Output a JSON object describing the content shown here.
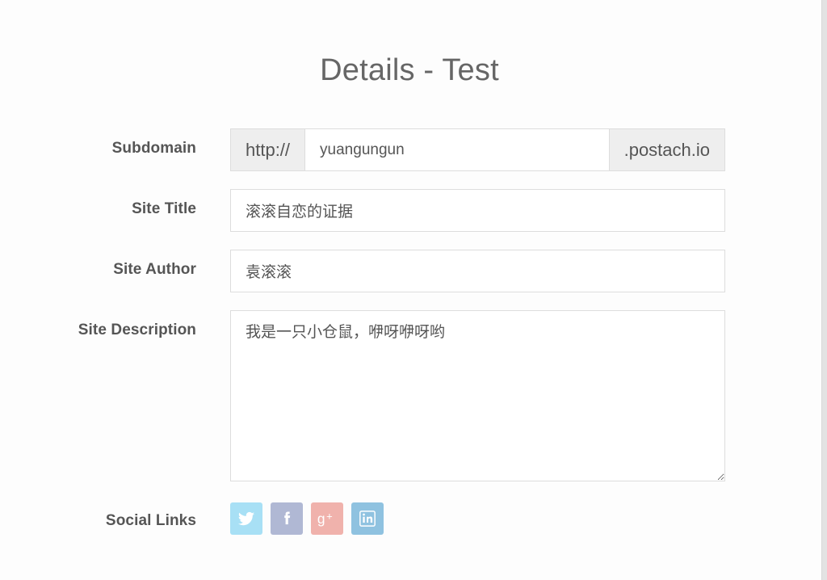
{
  "page": {
    "title": "Details - Test",
    "background_color": "#fdfdfd",
    "title_color": "#666666"
  },
  "form": {
    "subdomain": {
      "label": "Subdomain",
      "prefix": "http://",
      "value": "yuangungun",
      "placeholder": "",
      "suffix": ".postach.io"
    },
    "site_title": {
      "label": "Site Title",
      "value": "滚滚自恋的证据",
      "placeholder": ""
    },
    "site_author": {
      "label": "Site Author",
      "value": "袁滚滚",
      "placeholder": ""
    },
    "site_description": {
      "label": "Site Description",
      "value": "我是一只小仓鼠，咿呀咿呀哟",
      "placeholder": ""
    },
    "social_links": {
      "label": "Social Links",
      "items": [
        {
          "name": "twitter",
          "icon": "twitter-icon",
          "color": "#a8e0f5"
        },
        {
          "name": "facebook",
          "icon": "facebook-icon",
          "color": "#b0b8d4"
        },
        {
          "name": "google-plus",
          "icon": "google-plus-icon",
          "color": "#f0b2ac"
        },
        {
          "name": "linkedin",
          "icon": "linkedin-icon",
          "color": "#8fc2e0"
        }
      ]
    }
  }
}
